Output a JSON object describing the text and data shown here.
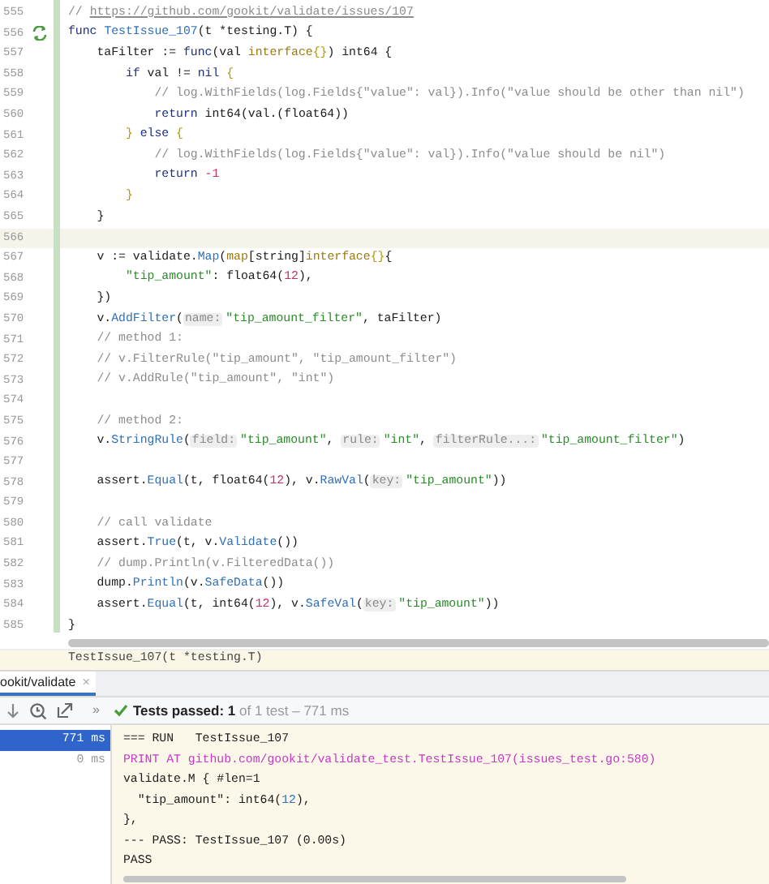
{
  "editor": {
    "lines": [
      {
        "number": "555",
        "current": false,
        "run_icon": false,
        "segments": [
          {
            "kind": "comment",
            "text": "// "
          },
          {
            "kind": "link",
            "text": "https://github.com/gookit/validate/issues/107"
          }
        ]
      },
      {
        "number": "556",
        "current": false,
        "run_icon": true,
        "segments": [
          {
            "kind": "keyword",
            "text": "func "
          },
          {
            "kind": "function",
            "text": "TestIssue_107"
          },
          {
            "kind": "plain",
            "text": "(t *testing.T) {"
          }
        ]
      },
      {
        "number": "557",
        "current": false,
        "run_icon": false,
        "segments": [
          {
            "kind": "plain",
            "text": "    taFilter := "
          },
          {
            "kind": "keyword",
            "text": "func"
          },
          {
            "kind": "plain",
            "text": "(val "
          },
          {
            "kind": "type",
            "text": "interface"
          },
          {
            "kind": "brace",
            "text": "{}"
          },
          {
            "kind": "plain",
            "text": ") int64 {"
          }
        ]
      },
      {
        "number": "558",
        "current": false,
        "run_icon": false,
        "segments": [
          {
            "kind": "keyword",
            "text": "        if "
          },
          {
            "kind": "plain",
            "text": "val != "
          },
          {
            "kind": "keyword",
            "text": "nil "
          },
          {
            "kind": "brace",
            "text": "{"
          }
        ]
      },
      {
        "number": "559",
        "current": false,
        "run_icon": false,
        "segments": [
          {
            "kind": "comment",
            "text": "            // log.WithFields(log.Fields{\"value\": val}).Info(\"value should be other than nil\")"
          }
        ]
      },
      {
        "number": "560",
        "current": false,
        "run_icon": false,
        "segments": [
          {
            "kind": "keyword",
            "text": "            return "
          },
          {
            "kind": "plain",
            "text": "int64(val.(float64))"
          }
        ]
      },
      {
        "number": "561",
        "current": false,
        "run_icon": false,
        "segments": [
          {
            "kind": "brace",
            "text": "        } "
          },
          {
            "kind": "keyword",
            "text": "else "
          },
          {
            "kind": "brace",
            "text": "{"
          }
        ]
      },
      {
        "number": "562",
        "current": false,
        "run_icon": false,
        "segments": [
          {
            "kind": "comment",
            "text": "            // log.WithFields(log.Fields{\"value\": val}).Info(\"value should be nil\")"
          }
        ]
      },
      {
        "number": "563",
        "current": false,
        "run_icon": false,
        "segments": [
          {
            "kind": "keyword",
            "text": "            return "
          },
          {
            "kind": "number",
            "text": "-1"
          }
        ]
      },
      {
        "number": "564",
        "current": false,
        "run_icon": false,
        "segments": [
          {
            "kind": "brace",
            "text": "        }"
          }
        ]
      },
      {
        "number": "565",
        "current": false,
        "run_icon": false,
        "segments": [
          {
            "kind": "plain",
            "text": "    }"
          }
        ]
      },
      {
        "number": "566",
        "current": true,
        "run_icon": false
      },
      {
        "number": "567",
        "current": false,
        "run_icon": false,
        "segments": [
          {
            "kind": "plain",
            "text": "    v := validate."
          },
          {
            "kind": "function",
            "text": "Map"
          },
          {
            "kind": "plain",
            "text": "("
          },
          {
            "kind": "type",
            "text": "map"
          },
          {
            "kind": "plain",
            "text": "[string]"
          },
          {
            "kind": "type",
            "text": "interface"
          },
          {
            "kind": "brace",
            "text": "{}"
          },
          {
            "kind": "plain",
            "text": "{"
          }
        ]
      },
      {
        "number": "568",
        "current": false,
        "run_icon": false,
        "segments": [
          {
            "kind": "string",
            "text": "        \"tip_amount\""
          },
          {
            "kind": "plain",
            "text": ": float64("
          },
          {
            "kind": "number",
            "text": "12"
          },
          {
            "kind": "plain",
            "text": "),"
          }
        ]
      },
      {
        "number": "569",
        "current": false,
        "run_icon": false,
        "segments": [
          {
            "kind": "plain",
            "text": "    })"
          }
        ]
      },
      {
        "number": "570",
        "current": false,
        "run_icon": false,
        "segments": [
          {
            "kind": "plain",
            "text": "    v."
          },
          {
            "kind": "function",
            "text": "AddFilter"
          },
          {
            "kind": "plain",
            "text": "("
          },
          {
            "kind": "hint",
            "text": "name:"
          },
          {
            "kind": "string",
            "text": "\"tip_amount_filter\""
          },
          {
            "kind": "plain",
            "text": ", taFilter)"
          }
        ]
      },
      {
        "number": "571",
        "current": false,
        "run_icon": false,
        "segments": [
          {
            "kind": "comment",
            "text": "    // method 1:"
          }
        ]
      },
      {
        "number": "572",
        "current": false,
        "run_icon": false,
        "segments": [
          {
            "kind": "comment",
            "text": "    // v.FilterRule(\"tip_amount\", \"tip_amount_filter\")"
          }
        ]
      },
      {
        "number": "573",
        "current": false,
        "run_icon": false,
        "segments": [
          {
            "kind": "comment",
            "text": "    // v.AddRule(\"tip_amount\", \"int\")"
          }
        ]
      },
      {
        "number": "574",
        "current": false,
        "run_icon": false
      },
      {
        "number": "575",
        "current": false,
        "run_icon": false,
        "segments": [
          {
            "kind": "comment",
            "text": "    // method 2:"
          }
        ]
      },
      {
        "number": "576",
        "current": false,
        "run_icon": false,
        "segments": [
          {
            "kind": "plain",
            "text": "    v."
          },
          {
            "kind": "function",
            "text": "StringRule"
          },
          {
            "kind": "plain",
            "text": "("
          },
          {
            "kind": "hint",
            "text": "field:"
          },
          {
            "kind": "string",
            "text": "\"tip_amount\""
          },
          {
            "kind": "plain",
            "text": ", "
          },
          {
            "kind": "hint",
            "text": "rule:"
          },
          {
            "kind": "string",
            "text": "\"int\""
          },
          {
            "kind": "plain",
            "text": ", "
          },
          {
            "kind": "hint",
            "text": "filterRule...:"
          },
          {
            "kind": "string",
            "text": "\"tip_amount_filter\""
          },
          {
            "kind": "plain",
            "text": ")"
          }
        ]
      },
      {
        "number": "577",
        "current": false,
        "run_icon": false
      },
      {
        "number": "578",
        "current": false,
        "run_icon": false,
        "segments": [
          {
            "kind": "plain",
            "text": "    assert."
          },
          {
            "kind": "function",
            "text": "Equal"
          },
          {
            "kind": "plain",
            "text": "(t, float64("
          },
          {
            "kind": "number",
            "text": "12"
          },
          {
            "kind": "plain",
            "text": "), v."
          },
          {
            "kind": "function",
            "text": "RawVal"
          },
          {
            "kind": "plain",
            "text": "("
          },
          {
            "kind": "hint",
            "text": "key:"
          },
          {
            "kind": "string",
            "text": "\"tip_amount\""
          },
          {
            "kind": "plain",
            "text": "))"
          }
        ]
      },
      {
        "number": "579",
        "current": false,
        "run_icon": false
      },
      {
        "number": "580",
        "current": false,
        "run_icon": false,
        "segments": [
          {
            "kind": "comment",
            "text": "    // call validate"
          }
        ]
      },
      {
        "number": "581",
        "current": false,
        "run_icon": false,
        "segments": [
          {
            "kind": "plain",
            "text": "    assert."
          },
          {
            "kind": "function",
            "text": "True"
          },
          {
            "kind": "plain",
            "text": "(t, v."
          },
          {
            "kind": "function",
            "text": "Validate"
          },
          {
            "kind": "plain",
            "text": "())"
          }
        ]
      },
      {
        "number": "582",
        "current": false,
        "run_icon": false,
        "segments": [
          {
            "kind": "comment",
            "text": "    // dump.Println(v.FilteredData())"
          }
        ]
      },
      {
        "number": "583",
        "current": false,
        "run_icon": false,
        "segments": [
          {
            "kind": "plain",
            "text": "    dump."
          },
          {
            "kind": "function",
            "text": "Println"
          },
          {
            "kind": "plain",
            "text": "(v."
          },
          {
            "kind": "function",
            "text": "SafeData"
          },
          {
            "kind": "plain",
            "text": "())"
          }
        ]
      },
      {
        "number": "584",
        "current": false,
        "run_icon": false,
        "segments": [
          {
            "kind": "plain",
            "text": "    assert."
          },
          {
            "kind": "function",
            "text": "Equal"
          },
          {
            "kind": "plain",
            "text": "(t, int64("
          },
          {
            "kind": "number",
            "text": "12"
          },
          {
            "kind": "plain",
            "text": "), v."
          },
          {
            "kind": "function",
            "text": "SafeVal"
          },
          {
            "kind": "plain",
            "text": "("
          },
          {
            "kind": "hint",
            "text": "key:"
          },
          {
            "kind": "string",
            "text": "\"tip_amount\""
          },
          {
            "kind": "plain",
            "text": "))"
          }
        ]
      },
      {
        "number": "585",
        "current": false,
        "run_icon": false,
        "segments": [
          {
            "kind": "plain",
            "text": "}"
          }
        ]
      }
    ]
  },
  "breadcrumb": "TestIssue_107(t *testing.T)",
  "run_tab": {
    "label": "ookit/validate",
    "close": "×",
    "selected": true
  },
  "toolbar": {
    "more": "»",
    "status": "**Tests passed: 1** of 1 test – 771 ms"
  },
  "test_tree": [
    {
      "time": "771 ms",
      "selected": true
    },
    {
      "time": "0 ms",
      "selected": false
    }
  ],
  "console": [
    [
      {
        "kind": "plain",
        "text": "=== RUN   TestIssue_107"
      }
    ],
    [
      {
        "kind": "print",
        "text": "PRINT AT github.com/gookit/validate_test.TestIssue_107(issues_test.go:580)"
      }
    ],
    [
      {
        "kind": "plain",
        "text": "validate.M { #len=1"
      }
    ],
    [
      {
        "kind": "plain",
        "text": "  \"tip_amount\": int64("
      },
      {
        "kind": "number",
        "text": "12"
      },
      {
        "kind": "plain",
        "text": "),"
      }
    ],
    [
      {
        "kind": "plain",
        "text": "},"
      }
    ],
    [
      {
        "kind": "plain",
        "text": "--- PASS: TestIssue_107 (0.00s)"
      }
    ],
    [
      {
        "kind": "plain",
        "text": "PASS"
      }
    ]
  ]
}
